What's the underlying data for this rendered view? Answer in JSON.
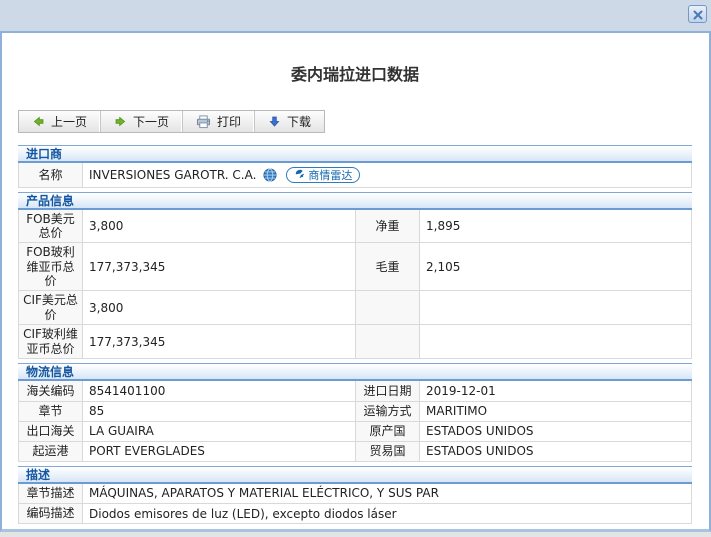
{
  "window": {
    "title": "委内瑞拉进口数据"
  },
  "toolbar": {
    "prev_label": "上一页",
    "next_label": "下一页",
    "print_label": "打印",
    "download_label": "下载"
  },
  "importer": {
    "header": "进口商",
    "name_label": "名称",
    "name_value": "INVERSIONES GAROTR. C.A.",
    "radar_label": "商情雷达"
  },
  "product": {
    "header": "产品信息",
    "rows": [
      {
        "l1": "FOB美元总价",
        "v1": "3,800",
        "l2": "净重",
        "v2": "1,895"
      },
      {
        "l1": "FOB玻利维亚币总价",
        "v1": "177,373,345",
        "l2": "毛重",
        "v2": "2,105"
      },
      {
        "l1": "CIF美元总价",
        "v1": "3,800",
        "l2": "",
        "v2": ""
      },
      {
        "l1": "CIF玻利维亚币总价",
        "v1": "177,373,345",
        "l2": "",
        "v2": ""
      }
    ]
  },
  "logistics": {
    "header": "物流信息",
    "rows": [
      {
        "l1": "海关编码",
        "v1": "8541401100",
        "l2": "进口日期",
        "v2": "2019-12-01"
      },
      {
        "l1": "章节",
        "v1": "85",
        "l2": "运输方式",
        "v2": "MARITIMO"
      },
      {
        "l1": "出口海关",
        "v1": "LA GUAIRA",
        "l2": "原产国",
        "v2": "ESTADOS UNIDOS"
      },
      {
        "l1": "起运港",
        "v1": "PORT EVERGLADES",
        "l2": "贸易国",
        "v2": "ESTADOS UNIDOS"
      }
    ]
  },
  "description": {
    "header": "描述",
    "rows": [
      {
        "l1": "章节描述",
        "v1": "MÁQUINAS, APARATOS Y MATERIAL ELÉCTRICO, Y SUS PAR"
      },
      {
        "l1": "编码描述",
        "v1": "Diodos emisores de luz (LED), excepto diodos láser"
      }
    ]
  },
  "colors": {
    "titlebar_bg": "#cdd9e7",
    "panel_border": "#8fb0da",
    "section_header_text": "#1456a0",
    "section_header_border": "#6b9bd2",
    "accent_blue": "#2f7bc0",
    "arrow_green": "#6fb32a",
    "arrow_blue": "#3b6fd4"
  }
}
